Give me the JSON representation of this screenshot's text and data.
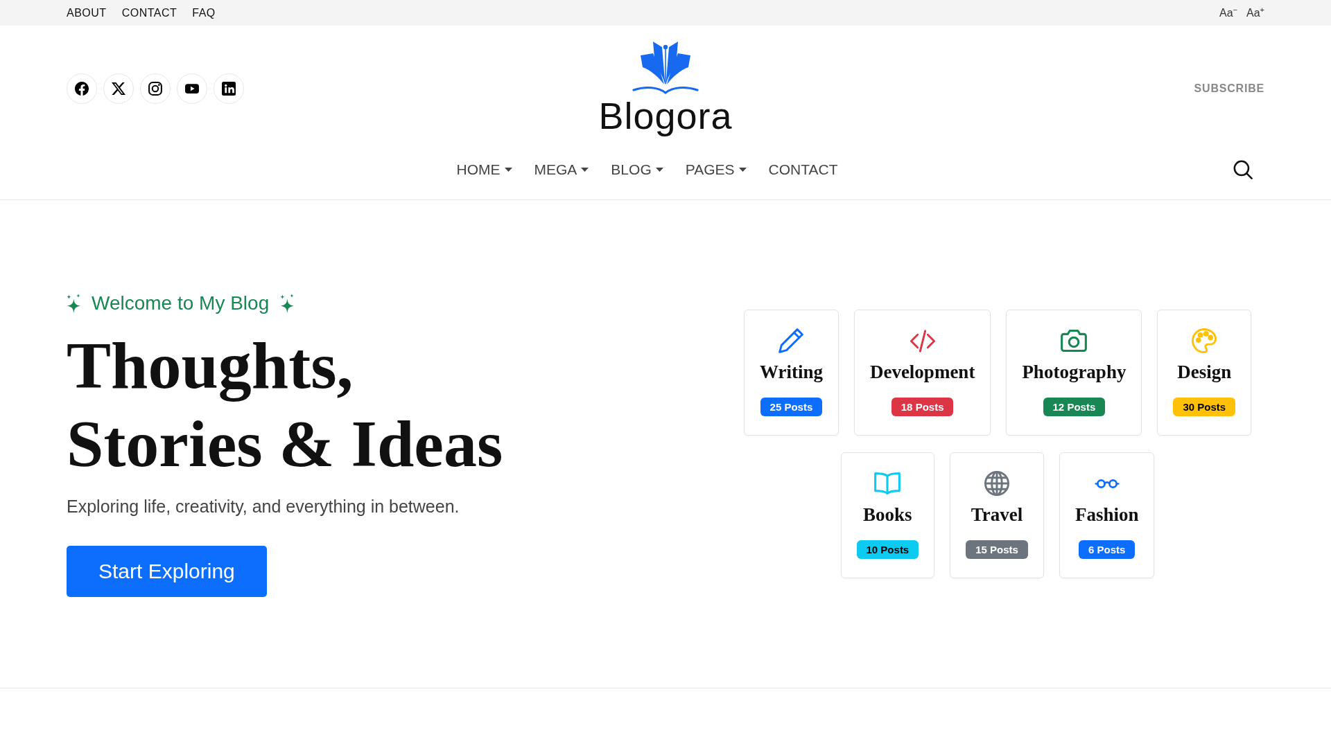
{
  "top_bar": {
    "links": [
      {
        "label": "ABOUT"
      },
      {
        "label": "CONTACT"
      },
      {
        "label": "FAQ"
      }
    ],
    "font_size_controls": [
      {
        "label": "Aa$^{−}$"
      },
      {
        "label": "Aa$^{+}$"
      }
    ]
  },
  "header": {
    "site_name": "Blogora",
    "subscribe": "SUBSCRIBE"
  },
  "nav": {
    "items": [
      {
        "label": "HOME",
        "dropdown": true
      },
      {
        "label": "MEGA",
        "dropdown": true
      },
      {
        "label": "BLOG",
        "dropdown": true
      },
      {
        "label": "PAGES",
        "dropdown": true
      },
      {
        "label": "CONTACT",
        "dropdown": false
      }
    ]
  },
  "hero": {
    "eyebrow": "Welcome to My Blog",
    "title": "Thoughts, Stories & Ideas",
    "subtitle": "Exploring life, creativity, and everything in between.",
    "button": "Start Exploring"
  },
  "categories": [
    {
      "name": "Writing",
      "count": "25 Posts",
      "color": "#0d6efd"
    },
    {
      "name": "Development",
      "count": "18 Posts",
      "color": "#dc3545"
    },
    {
      "name": "Photography",
      "count": "12 Posts",
      "color": "#198754"
    },
    {
      "name": "Design",
      "count": "30 Posts",
      "color": "#ffc107"
    },
    {
      "name": "Books",
      "count": "10 Posts",
      "color": "#0dcaf0"
    },
    {
      "name": "Travel",
      "count": "15 Posts",
      "color": "#6c757d"
    },
    {
      "name": "Fashion",
      "count": "6 Posts",
      "color": "#0d6efd"
    }
  ]
}
